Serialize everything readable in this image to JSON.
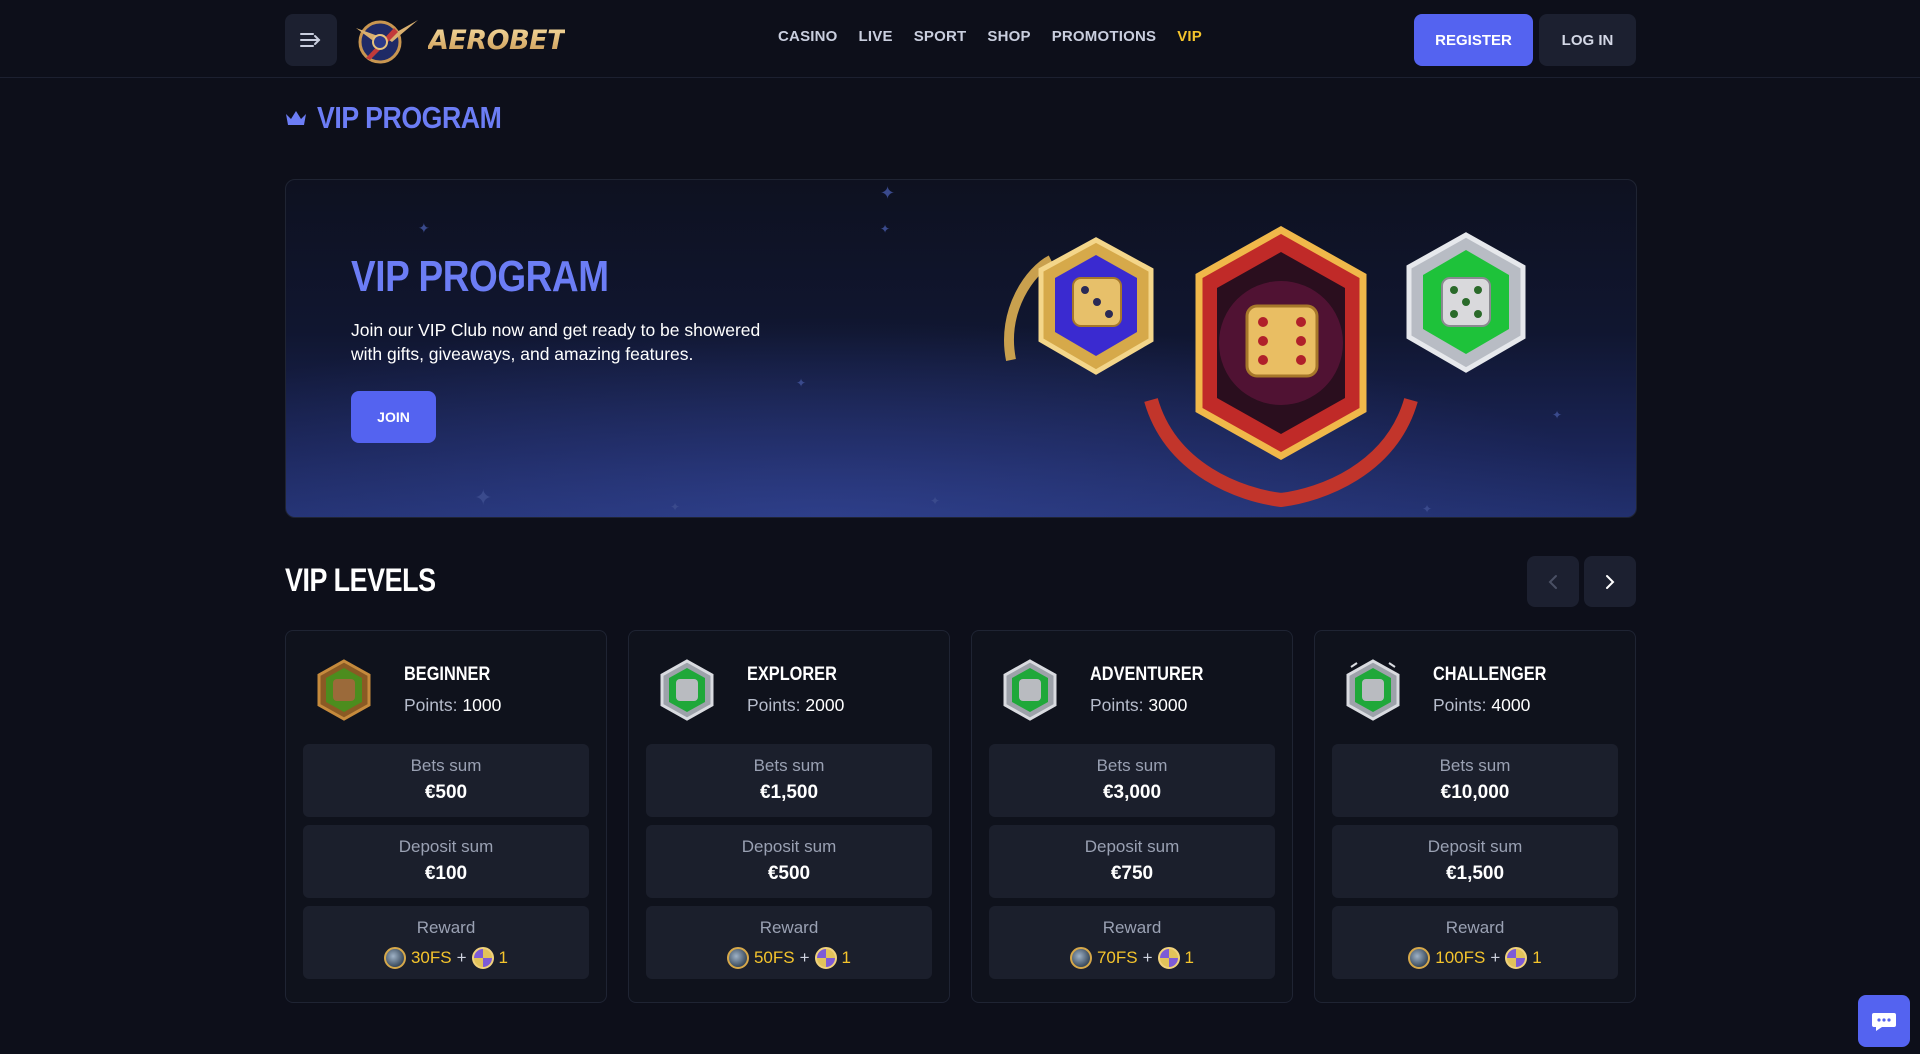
{
  "header": {
    "logo_text": "AEROBET",
    "nav": [
      {
        "label": "CASINO",
        "active": false
      },
      {
        "label": "LIVE",
        "active": false
      },
      {
        "label": "SPORT",
        "active": false
      },
      {
        "label": "SHOP",
        "active": false
      },
      {
        "label": "PROMOTIONS",
        "active": false
      },
      {
        "label": "VIP",
        "active": true
      }
    ],
    "register_label": "REGISTER",
    "login_label": "LOG IN",
    "menu_icon": "menu-toggle-icon"
  },
  "page": {
    "title": "VIP PROGRAM",
    "title_icon": "crown-icon"
  },
  "hero": {
    "title": "VIP PROGRAM",
    "description": "Join our VIP Club now and get ready to be showered with gifts, giveaways, and amazing features.",
    "join_label": "JOIN"
  },
  "levels": {
    "title": "VIP LEVELS",
    "prev_icon": "chevron-left-icon",
    "next_icon": "chevron-right-icon",
    "points_label": "Points:",
    "bets_label": "Bets sum",
    "deposit_label": "Deposit sum",
    "reward_label": "Reward",
    "plus": "+",
    "items": [
      {
        "name": "BEGINNER",
        "points": "1000",
        "bets": "€500",
        "deposit": "€100",
        "reward_fs": "30FS",
        "reward_wheel": "1"
      },
      {
        "name": "EXPLORER",
        "points": "2000",
        "bets": "€1,500",
        "deposit": "€500",
        "reward_fs": "50FS",
        "reward_wheel": "1"
      },
      {
        "name": "ADVENTURER",
        "points": "3000",
        "bets": "€3,000",
        "deposit": "€750",
        "reward_fs": "70FS",
        "reward_wheel": "1"
      },
      {
        "name": "CHALLENGER",
        "points": "4000",
        "bets": "€10,000",
        "deposit": "€1,500",
        "reward_fs": "100FS",
        "reward_wheel": "1"
      }
    ]
  },
  "colors": {
    "accent": "#5463f0",
    "title_blue": "#6c7df5",
    "vip_active": "#f4c42c",
    "background": "#0d0f1a"
  },
  "chat_icon": "chat-support-icon"
}
